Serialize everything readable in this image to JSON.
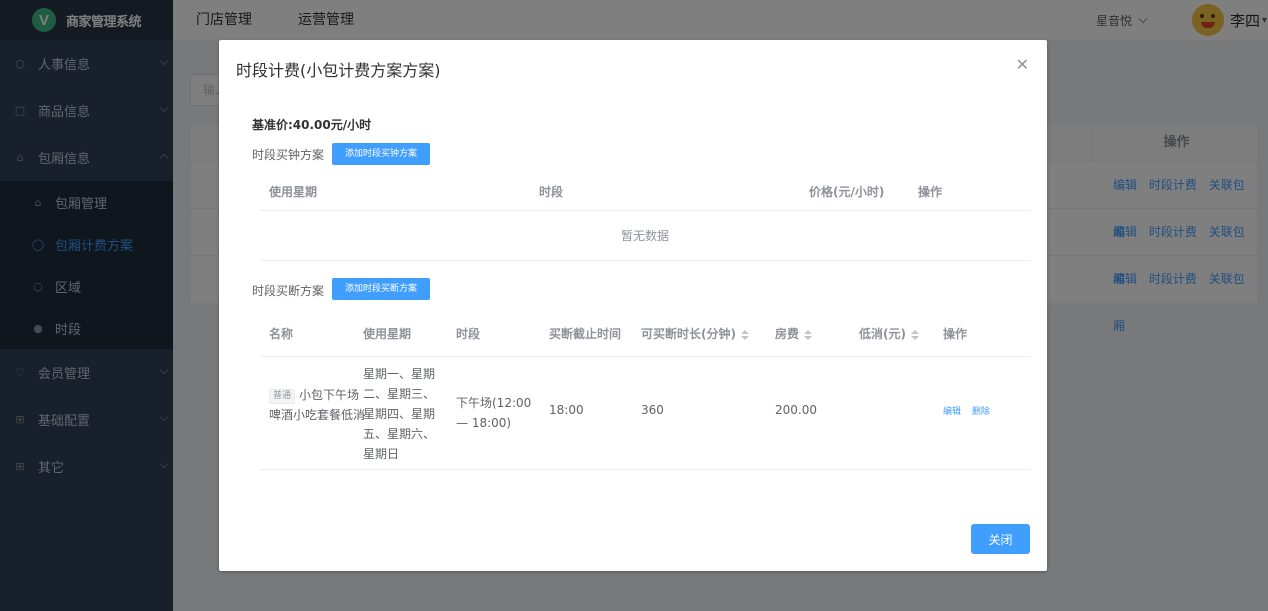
{
  "app": {
    "logo_letter": "V",
    "title": "商家管理系统"
  },
  "sidebar": {
    "items": [
      {
        "label": "人事信息",
        "icon": "user-icon"
      },
      {
        "label": "商品信息",
        "icon": "goods-icon"
      },
      {
        "label": "包厢信息",
        "icon": "home-icon",
        "expanded": true,
        "children": [
          {
            "label": "包厢管理",
            "icon": "home-icon"
          },
          {
            "label": "包厢计费方案",
            "icon": "shield-icon",
            "active": true
          },
          {
            "label": "区域",
            "icon": "user-icon"
          },
          {
            "label": "时段",
            "icon": "clock-icon"
          }
        ]
      },
      {
        "label": "会员管理",
        "icon": "crown-icon"
      },
      {
        "label": "基础配置",
        "icon": "grid-icon"
      },
      {
        "label": "其它",
        "icon": "grid-icon"
      }
    ]
  },
  "header": {
    "tabs": [
      "门店管理",
      "运营管理"
    ],
    "store": "星音悦",
    "user": "李四"
  },
  "background_page": {
    "search_placeholder": "输入",
    "op_header": "操作",
    "row_ops": [
      "编辑",
      "时段计费",
      "关联包厢"
    ]
  },
  "modal": {
    "title": "时段计费(小包计费方案方案)",
    "base_price": "基准价:40.00元/小时",
    "section1": {
      "label": "时段买钟方案",
      "add_button": "添加时段买钟方案",
      "columns": [
        "使用星期",
        "时段",
        "价格(元/小时)",
        "操作"
      ],
      "empty_text": "暂无数据"
    },
    "section2": {
      "label": "时段买断方案",
      "add_button": "添加时段买断方案",
      "columns": [
        "名称",
        "使用星期",
        "时段",
        "买断截止时间",
        "可买断时长(分钟)",
        "房费",
        "低消(元)",
        "操作"
      ],
      "rows": [
        {
          "tag": "普通",
          "name": "小包下午场啤酒小吃套餐低消",
          "days": "星期一、星期二、星期三、星期四、星期五、星期六、星期日",
          "period": "下午场(12:00 — 18:00)",
          "cutoff": "18:00",
          "duration": "360",
          "fee": "200.00",
          "min_spend": "",
          "actions": [
            "编辑",
            "删除"
          ]
        }
      ]
    },
    "close_button": "关闭"
  }
}
